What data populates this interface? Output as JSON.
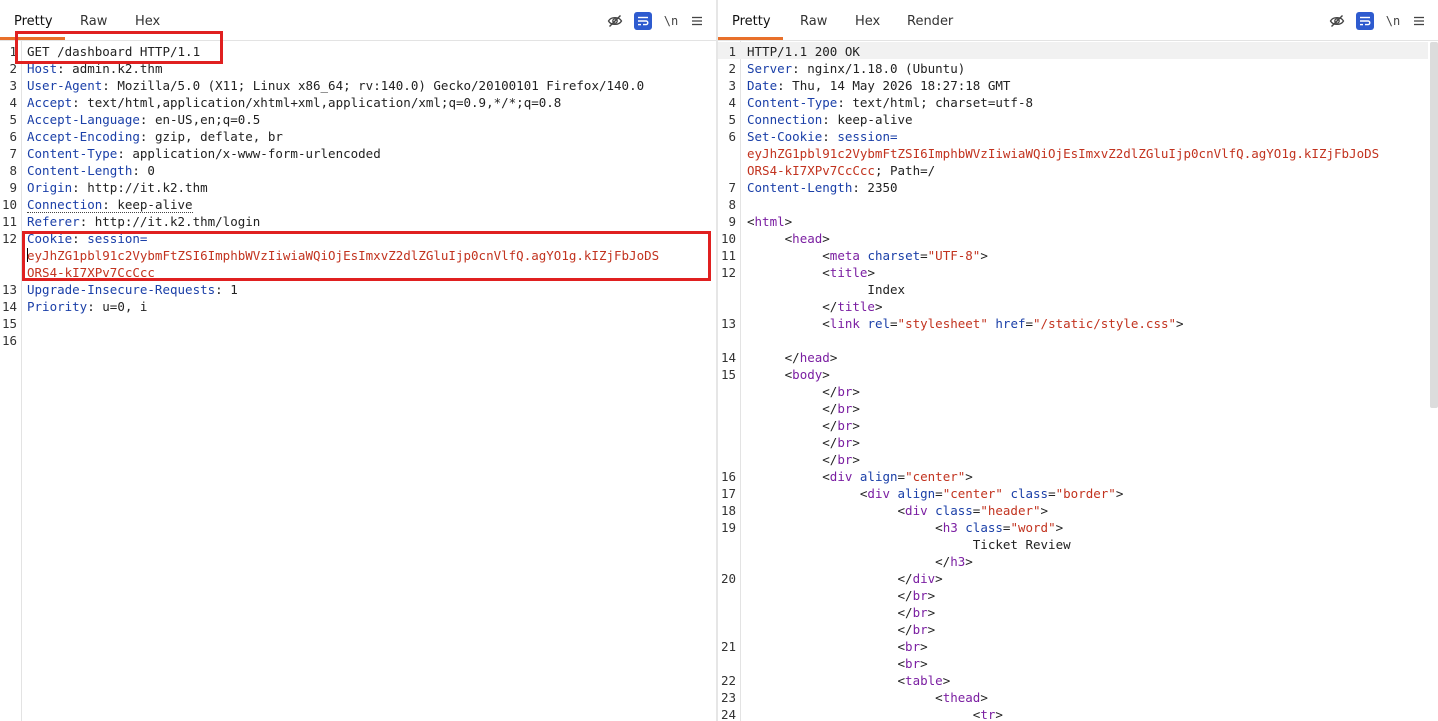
{
  "request": {
    "tabs": [
      "Pretty",
      "Raw",
      "Hex"
    ],
    "active_tab": "Pretty",
    "line_numbers": [
      "1",
      "2",
      "3",
      "4",
      "5",
      "6",
      "7",
      "8",
      "9",
      "10",
      "11",
      "12",
      "13",
      "14",
      "15",
      "16"
    ],
    "request_line": "GET /dashboard HTTP/1.1",
    "headers": [
      {
        "name": "Host",
        "value": "admin.k2.thm"
      },
      {
        "name": "User-Agent",
        "value": "Mozilla/5.0 (X11; Linux x86_64; rv:140.0) Gecko/20100101 Firefox/140.0"
      },
      {
        "name": "Accept",
        "value": "text/html,application/xhtml+xml,application/xml;q=0.9,*/*;q=0.8"
      },
      {
        "name": "Accept-Language",
        "value": "en-US,en;q=0.5"
      },
      {
        "name": "Accept-Encoding",
        "value": "gzip, deflate, br"
      },
      {
        "name": "Content-Type",
        "value": "application/x-www-form-urlencoded"
      },
      {
        "name": "Content-Length",
        "value": "0"
      },
      {
        "name": "Origin",
        "value": "http://it.k2.thm"
      },
      {
        "name": "Connection",
        "value": "keep-alive"
      },
      {
        "name": "Referer",
        "value": "http://it.k2.thm/login"
      }
    ],
    "cookie": {
      "name": "Cookie",
      "key": "session=",
      "value_line1": "eyJhZG1pbl91c2VybmFtZSI6ImphbWVzIiwiaWQiOjEsImxvZ2dlZGluIjp0cnVlfQ.agYO1g.kIZjFbJoDS",
      "value_line2": "ORS4-kI7XPv7CcCcc"
    },
    "headers_after": [
      {
        "name": "Upgrade-Insecure-Requests",
        "value": "1"
      },
      {
        "name": "Priority",
        "value": "u=0, i"
      }
    ]
  },
  "response": {
    "tabs": [
      "Pretty",
      "Raw",
      "Hex",
      "Render"
    ],
    "active_tab": "Pretty",
    "status_line": "HTTP/1.1 200 OK",
    "headers": [
      {
        "name": "Server",
        "value": "nginx/1.18.0 (Ubuntu)"
      },
      {
        "name": "Date",
        "value": "Thu, 14 May 2026 18:27:18 GMT"
      },
      {
        "name": "Content-Type",
        "value": "text/html; charset=utf-8"
      },
      {
        "name": "Connection",
        "value": "keep-alive"
      }
    ],
    "set_cookie": {
      "name": "Set-Cookie",
      "key": "session=",
      "value_line1": "eyJhZG1pbl91c2VybmFtZSI6ImphbWVzIiwiaWQiOjEsImxvZ2dlZGluIjp0cnVlfQ.agYO1g.kIZjFbJoDS",
      "value_line2": "ORS4-kI7XPv7CcCcc",
      "suffix": "; Path=/"
    },
    "content_length": {
      "name": "Content-Length",
      "value": "2350"
    },
    "title_text": "Index",
    "h3_text": "Ticket Review",
    "meta_charset": "\"UTF-8\"",
    "link_rel": "\"stylesheet\"",
    "link_href": "\"/static/style.css\"",
    "align_center": "\"center\"",
    "class_border": "\"border\"",
    "class_header": "\"header\"",
    "class_word": "\"word\"",
    "line_numbers": [
      {
        "n": "1"
      },
      {
        "n": "2"
      },
      {
        "n": "3"
      },
      {
        "n": "4"
      },
      {
        "n": "5"
      },
      {
        "n": "6"
      },
      {
        "n": "7"
      },
      {
        "n": "8"
      },
      {
        "n": "9"
      },
      {
        "n": "10"
      },
      {
        "n": "11"
      },
      {
        "n": "12"
      },
      {
        "n": "13"
      },
      {
        "n": "14"
      },
      {
        "n": "15"
      },
      {
        "n": "16"
      },
      {
        "n": "17"
      },
      {
        "n": "18"
      },
      {
        "n": "19"
      },
      {
        "n": "20"
      },
      {
        "n": "21"
      },
      {
        "n": "22"
      },
      {
        "n": "23"
      },
      {
        "n": "24"
      }
    ]
  },
  "toolbar_icons": [
    "eye-off-icon",
    "wrap-lines-icon",
    "newline-icon",
    "menu-icon"
  ],
  "newline_label": "\\n",
  "colors": {
    "accent": "#e8702a",
    "highlight_box": "#e02020",
    "active_icon": "#2e5bcf"
  }
}
